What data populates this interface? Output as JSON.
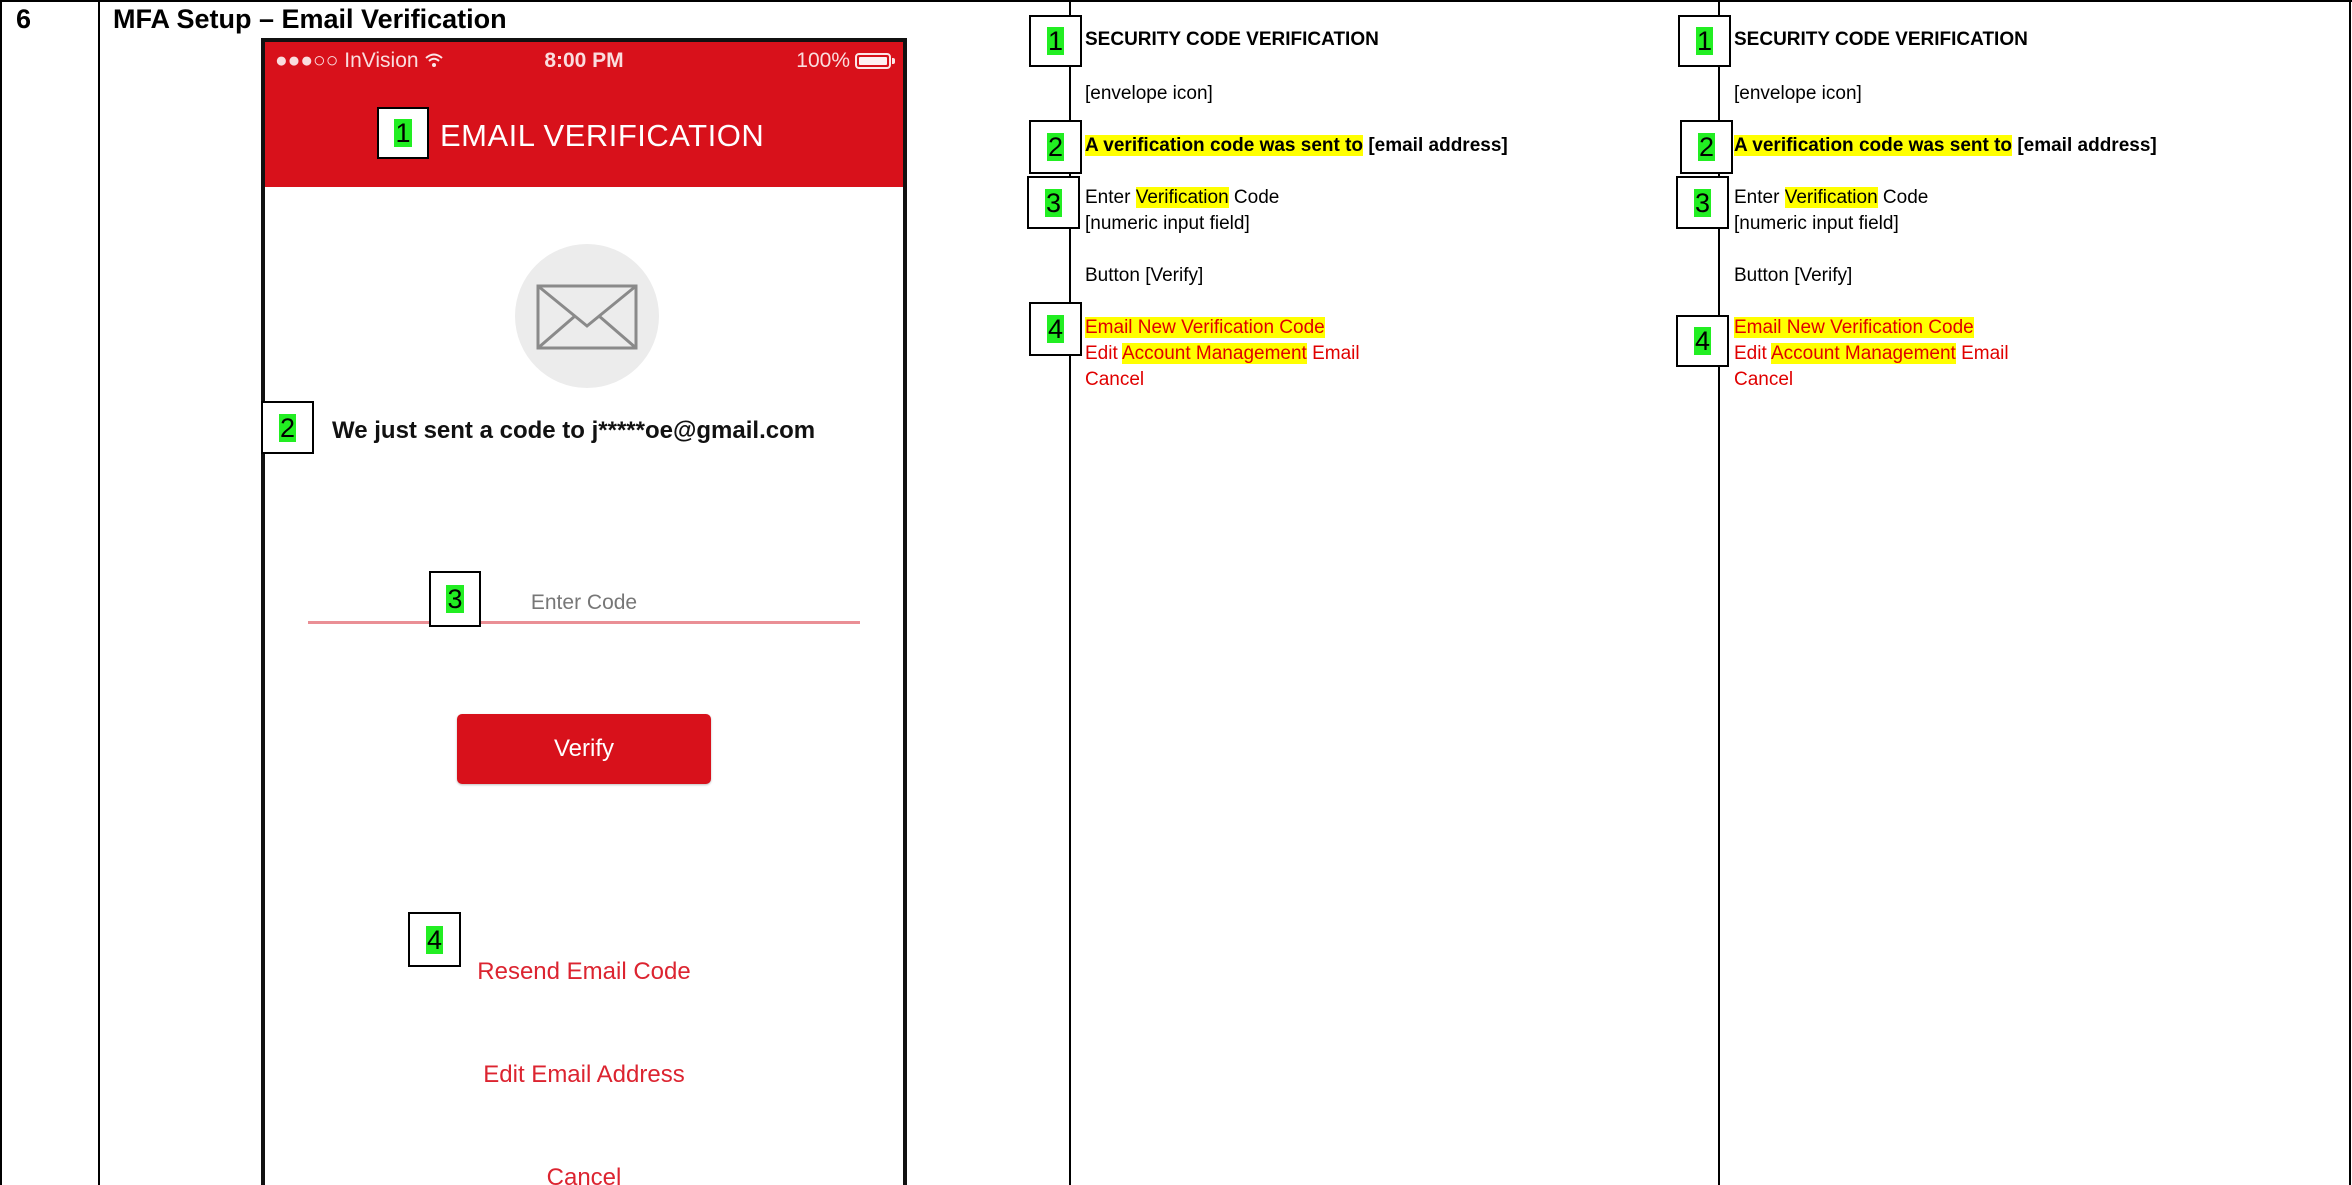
{
  "row": {
    "number": "6",
    "title": "MFA Setup – Email Verification"
  },
  "phone": {
    "status_carrier": "●●●○○ InVision",
    "wifi_icon": "wifi-icon",
    "status_time": "8:00 PM",
    "status_battery": "100%",
    "header_title": "EMAIL VERIFICATION",
    "header_color": "#d8111b",
    "envelope_icon": "envelope-icon",
    "sent_message": "We just sent a code to j*****oe@gmail.com",
    "code_placeholder": "Enter Code",
    "verify_label": "Verify",
    "resend_label": "Resend Email Code",
    "edit_email_label": "Edit Email Address",
    "cancel_label": "Cancel"
  },
  "badges": {
    "one": "1",
    "two": "2",
    "three": "3",
    "four": "4"
  },
  "spec_columns": [
    {
      "title": "SECURITY CODE VERIFICATION",
      "envelope": "[envelope icon]",
      "sent_hl": "A verification code was sent to",
      "sent_rest": " [email address]",
      "enter_pre": "Enter ",
      "enter_hl": "Verification",
      "enter_post": " Code",
      "input_field": "[numeric input field]",
      "button": "Button [Verify]",
      "link_email_new": "Email New Verification Code",
      "link_edit_pre": "Edit ",
      "link_edit_hl": "Account Management",
      "link_edit_post": " Email",
      "link_cancel": "Cancel"
    },
    {
      "title": "SECURITY CODE VERIFICATION",
      "envelope": "[envelope icon]",
      "sent_hl": "A verification code was sent to",
      "sent_rest": " [email address]",
      "enter_pre": "Enter ",
      "enter_hl": "Verification",
      "enter_post": " Code",
      "input_field": "[numeric input field]",
      "button": "Button [Verify]",
      "link_email_new": "Email New Verification Code",
      "link_edit_pre": "Edit ",
      "link_edit_hl": "Account Management",
      "link_edit_post": " Email",
      "link_cancel": "Cancel"
    }
  ],
  "colors": {
    "highlight": "#ffff00",
    "badge_highlight": "#22ee22",
    "link_red": "#e00000"
  }
}
